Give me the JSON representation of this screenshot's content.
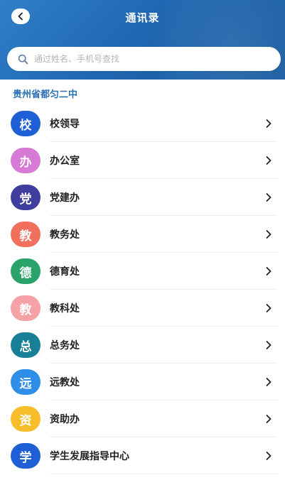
{
  "header": {
    "title": "通讯录",
    "back_icon": "chevron-left-icon"
  },
  "search": {
    "placeholder": "通过姓名、手机号查找",
    "icon": "search-icon"
  },
  "section": {
    "title": "贵州省都匀二中"
  },
  "colors": {
    "header": "#1d64ad",
    "section_title": "#2a6fb3"
  },
  "departments": [
    {
      "initial": "校",
      "label": "校领导",
      "color": "#1f5fd6"
    },
    {
      "initial": "办",
      "label": "办公室",
      "color": "#d77ad6"
    },
    {
      "initial": "党",
      "label": "党建办",
      "color": "#3f3d9e"
    },
    {
      "initial": "教",
      "label": "教务处",
      "color": "#f26f5e"
    },
    {
      "initial": "德",
      "label": "德育处",
      "color": "#2aa36a"
    },
    {
      "initial": "教",
      "label": "教科处",
      "color": "#f6a1a5"
    },
    {
      "initial": "总",
      "label": "总务处",
      "color": "#187f96"
    },
    {
      "initial": "远",
      "label": "远教处",
      "color": "#2f8ee8"
    },
    {
      "initial": "资",
      "label": "资助办",
      "color": "#f7bd2b"
    },
    {
      "initial": "学",
      "label": "学生发展指导中心",
      "color": "#1f5fd6"
    }
  ]
}
